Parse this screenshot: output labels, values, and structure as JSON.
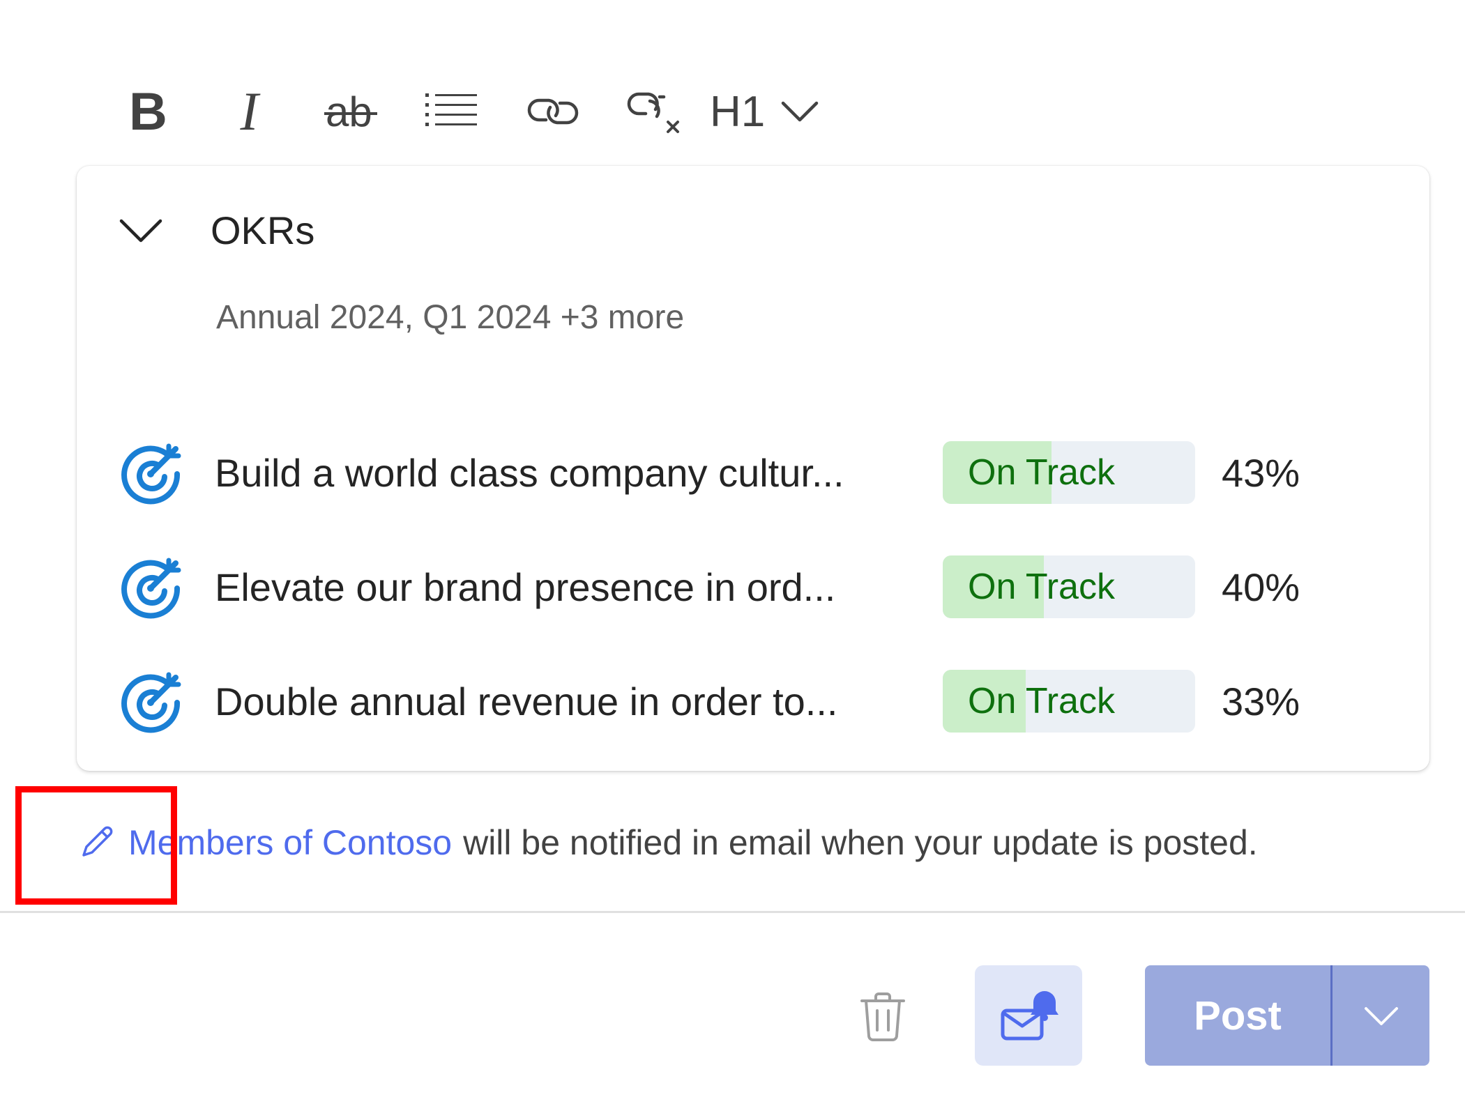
{
  "toolbar": {
    "bold_label": "B",
    "italic_label": "I",
    "heading_label": "H1",
    "icons": [
      "strikethrough-icon",
      "bullet-list-icon",
      "link-icon",
      "remove-link-icon",
      "chevron-down-icon"
    ]
  },
  "okr_card": {
    "title": "OKRs",
    "subtitle": "Annual 2024, Q1 2024 +3 more",
    "items": [
      {
        "title": "Build a world class company cultur...",
        "status": "On Track",
        "progress": 43,
        "progress_label": "43%"
      },
      {
        "title": "Elevate our brand presence in ord...",
        "status": "On Track",
        "progress": 40,
        "progress_label": "40%"
      },
      {
        "title": "Double annual revenue in order to...",
        "status": "On Track",
        "progress": 33,
        "progress_label": "33%"
      }
    ]
  },
  "notice": {
    "link_text": "Members of Contoso",
    "rest_text": "will be notified in email when your update is posted."
  },
  "footer": {
    "post_label": "Post"
  },
  "colors": {
    "accent": "#4f6bed",
    "okr_icon": "#1a7fd4",
    "status_green_text": "#0e700e",
    "status_green_fill": "#cbeec9",
    "status_track": "#ebf0f5",
    "post_button": "#9aa9dd",
    "highlight": "#ff0000"
  }
}
